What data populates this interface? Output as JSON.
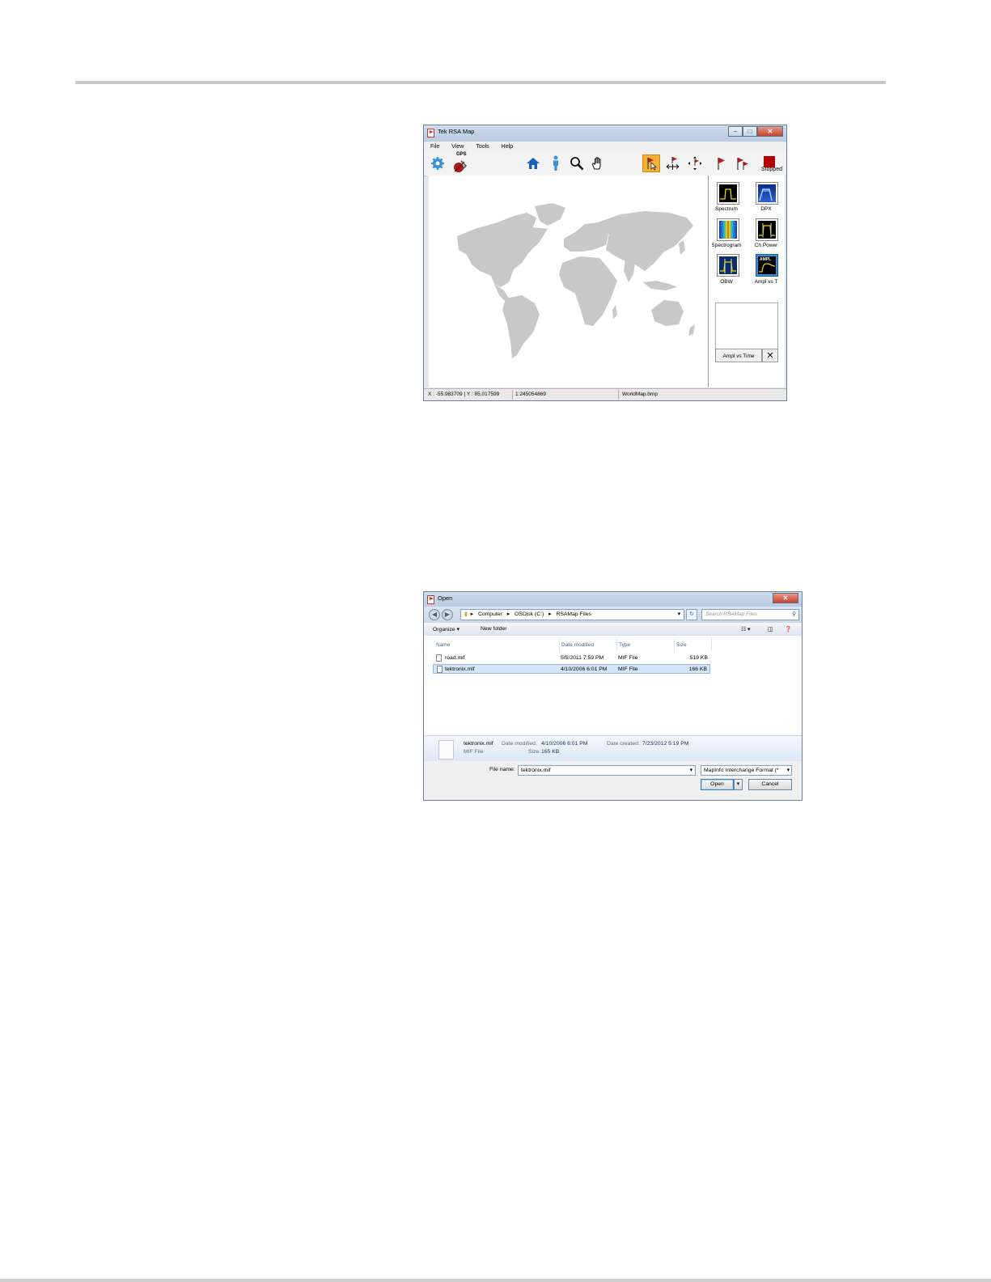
{
  "map_window": {
    "title": "Tek RSA Map",
    "menu": [
      "File",
      "View",
      "Tools",
      "Help"
    ],
    "toolbar": {
      "gps_label": "GPS",
      "stopped_label": "Stopped",
      "icons": [
        "gear-icon",
        "gps-icon",
        "home-icon",
        "person-icon",
        "magnifier-icon",
        "hand-icon",
        "flag-pointer-icon",
        "flag-move-icon",
        "flag-select-icon",
        "flag-icon",
        "flag-multi-icon",
        "stop-icon"
      ]
    },
    "measurements": [
      {
        "label": "Spectrum",
        "icon": "spectrum-icon"
      },
      {
        "label": "DPX",
        "icon": "dpx-icon"
      },
      {
        "label": "Spectrogram",
        "icon": "spectrogram-icon"
      },
      {
        "label": "Ch Power",
        "icon": "ch-power-icon"
      },
      {
        "label": "OBW",
        "icon": "obw-icon"
      },
      {
        "label": "Ampl vs T",
        "icon": "ampl-vs-time-icon"
      }
    ],
    "ampl_tile_text": "AMPL",
    "preview_button": "Ampl vs Time",
    "status": {
      "coords": "X : -55.983709 | Y : 85.017599",
      "scale": "1:245054869",
      "file": "WorldMap.bmp"
    },
    "colors": {
      "active_tool": "#f2b233",
      "map_land": "#c8c8c8",
      "stop": "#b30000"
    }
  },
  "open_dialog": {
    "title": "Open",
    "breadcrumb": [
      "Computer",
      "OSDisk (C:)",
      "RSAMap Files"
    ],
    "search_placeholder": "Search RSAMap Files",
    "commands": {
      "organize": "Organize ▾",
      "new_folder": "New folder"
    },
    "columns": [
      "Name",
      "Date modified",
      "Type",
      "Size"
    ],
    "files": [
      {
        "name": "road.mif",
        "date": "5/5/2011 7:59 PM",
        "type": "MIF File",
        "size": "519 KB"
      },
      {
        "name": "tektronix.mif",
        "date": "4/10/2006 6:01 PM",
        "type": "MIF File",
        "size": "166 KB"
      }
    ],
    "details": {
      "name": "tektronix.mif",
      "date_modified_label": "Date modified:",
      "date_modified": "4/10/2006 6:01 PM",
      "date_created_label": "Date created:",
      "date_created": "7/23/2012 5:19 PM",
      "type": "MIF File",
      "size_label": "Size:",
      "size": "165 KB"
    },
    "file_name_label": "File name:",
    "file_name_value": "tektronix.mif",
    "file_type_filter": "MapInfo Interchange Format (*",
    "open_button": "Open",
    "cancel_button": "Cancel"
  }
}
